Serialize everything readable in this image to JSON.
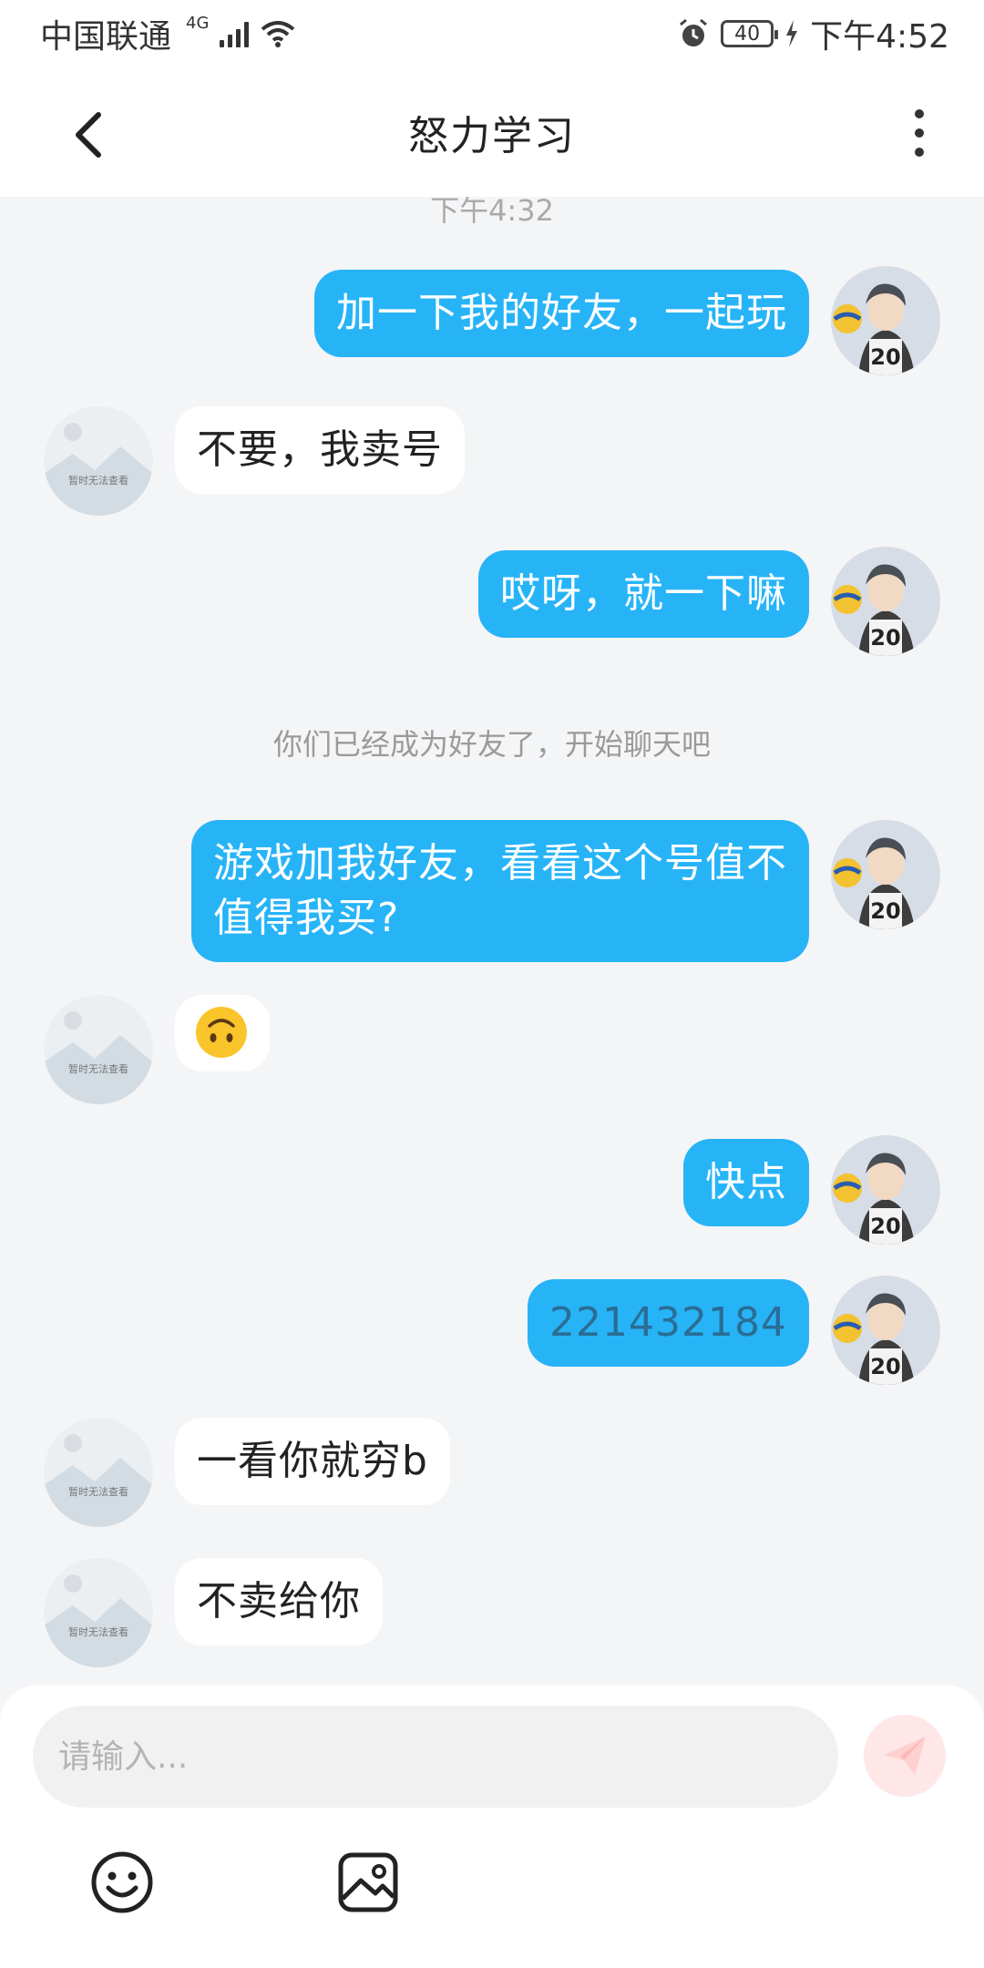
{
  "status_bar": {
    "carrier": "中国联通",
    "network": "4G",
    "battery": "40",
    "time": "下午4:52"
  },
  "header": {
    "title": "怒力学习"
  },
  "chat": {
    "timestamp": "下午4:32",
    "system_note": "你们已经成为好友了，开始聊天吧",
    "placeholder_avatar_text": "暂时无法查看",
    "messages": [
      {
        "side": "sent",
        "text": "加一下我的好友，一起玩"
      },
      {
        "side": "recv",
        "text": "不要，我卖号"
      },
      {
        "side": "sent",
        "text": "哎呀，就一下嘛"
      },
      {
        "side": "sent",
        "line1": "游戏加我好友，看看这个号值不",
        "line2": "值得我买?"
      },
      {
        "side": "recv",
        "emoji": "upside-down-face"
      },
      {
        "side": "sent",
        "text": "快点"
      },
      {
        "side": "sent",
        "text": "221432184"
      },
      {
        "side": "recv",
        "text": "一看你就穷b"
      },
      {
        "side": "recv",
        "text": "不卖给你"
      }
    ]
  },
  "input": {
    "placeholder": "请输入..."
  },
  "colors": {
    "sent_bubble": "#27b4f7",
    "recv_bubble": "#ffffff",
    "background": "#f4f5f7",
    "send_button": "#ffe7e7"
  },
  "icons": {
    "back": "chevron-left-icon",
    "more": "more-vertical-icon",
    "send": "paper-plane-icon",
    "emoji": "smiley-icon",
    "image": "image-icon",
    "alarm": "alarm-icon",
    "wifi": "wifi-icon"
  }
}
